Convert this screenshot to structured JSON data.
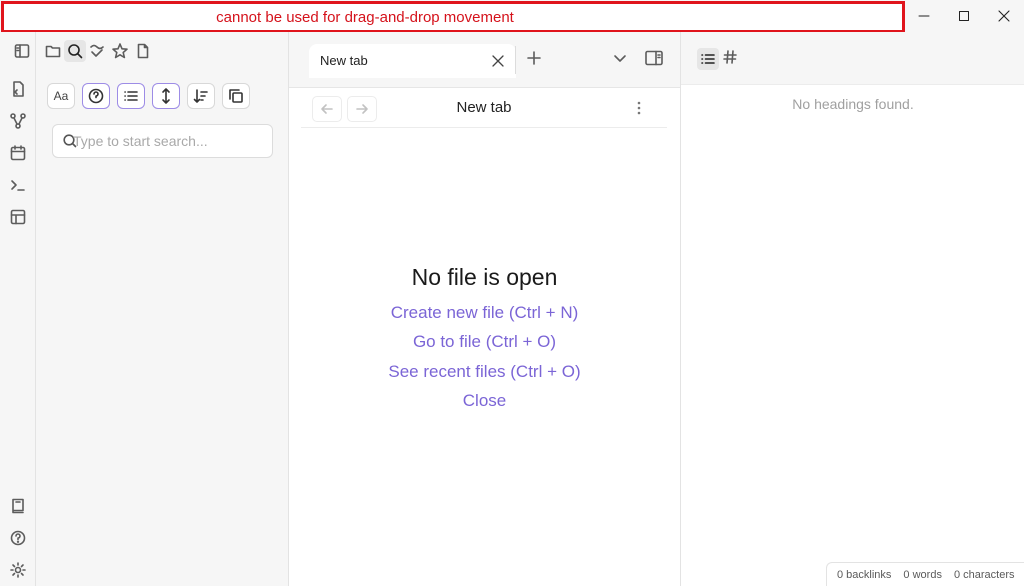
{
  "titlebar": {
    "warning": "cannot be used for drag-and-drop movement"
  },
  "search": {
    "placeholder": "Type to start search...",
    "value": "",
    "option_match_case": "Aa"
  },
  "tabs": [
    {
      "label": "New tab"
    }
  ],
  "view": {
    "title": "New tab"
  },
  "empty_state": {
    "title": "No file is open",
    "actions": [
      "Create new file (Ctrl + N)",
      "Go to file (Ctrl + O)",
      "See recent files (Ctrl + O)",
      "Close"
    ]
  },
  "outline": {
    "empty_message": "No headings found."
  },
  "status": {
    "backlinks": "0 backlinks",
    "words": "0 words",
    "characters": "0 characters"
  },
  "colors": {
    "accent": "#7b65d6",
    "warning": "#e0141c",
    "panel_bg": "#f6f6f6"
  },
  "icons": {
    "ribbon": [
      "open-quick-switcher-icon",
      "graph-view-icon",
      "daily-note-calendar-icon",
      "command-palette-icon",
      "templates-icon",
      "vault-icon",
      "help-icon",
      "settings-icon"
    ],
    "sidebar_tabs": [
      "toggle-left-sidebar-icon",
      "file-explorer-icon",
      "search-icon",
      "bookmarks-icon",
      "starred-icon",
      "new-file-icon"
    ]
  }
}
